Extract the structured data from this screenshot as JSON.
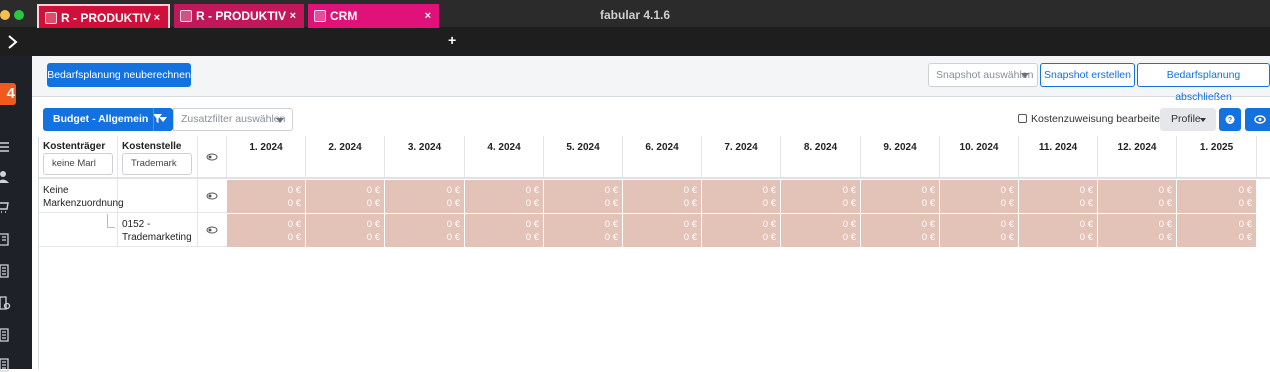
{
  "window": {
    "title": "fabular 4.1.6"
  },
  "tabs": [
    {
      "label": "R - PRODUKTIV",
      "close": "×",
      "color": "#d0103a"
    },
    {
      "label": "R - PRODUKTIV",
      "close": "×",
      "color": "#c2185b"
    },
    {
      "label": "CRM",
      "close": "×",
      "color": "#e0127a"
    }
  ],
  "tab_add": "+",
  "toolbar": {
    "recalc_label": "Bedarfsplanung neuberechnen",
    "snapshot_select_placeholder": "Snapshot auswählen",
    "snapshot_create_label": "Snapshot erstellen",
    "finish_label": "Bedarfsplanung abschließen"
  },
  "filters": {
    "budget_label": "Budget - Allgemein",
    "extra_filter_placeholder": "Zusatzfilter auswählen",
    "cost_assignment_label": "Kostenzuweisung bearbeiten",
    "profile_label": "Profile"
  },
  "table": {
    "col_kostentraeger": "Kostenträger",
    "col_kostenstelle": "Kostenstelle",
    "filter_kostentraeger": "keine Marl",
    "filter_kostenstelle": "Trademark",
    "months": [
      "1. 2024",
      "2. 2024",
      "3. 2024",
      "4. 2024",
      "5. 2024",
      "6. 2024",
      "7. 2024",
      "8. 2024",
      "9. 2024",
      "10. 2024",
      "11. 2024",
      "12. 2024",
      "1. 2025"
    ],
    "rows": [
      {
        "kostentraeger": "Keine Markenzuordnung",
        "kostenstelle": "",
        "values": [
          "0 €",
          "0 €"
        ]
      },
      {
        "kostentraeger": "",
        "kostenstelle": "0152 - Trademarketing",
        "values": [
          "0 €",
          "0 €"
        ]
      }
    ],
    "cell_value": "0 €"
  },
  "colors": {
    "accent": "#1371e0",
    "cell_bg": "#e3c2b8",
    "logo": "#f05a1f"
  }
}
